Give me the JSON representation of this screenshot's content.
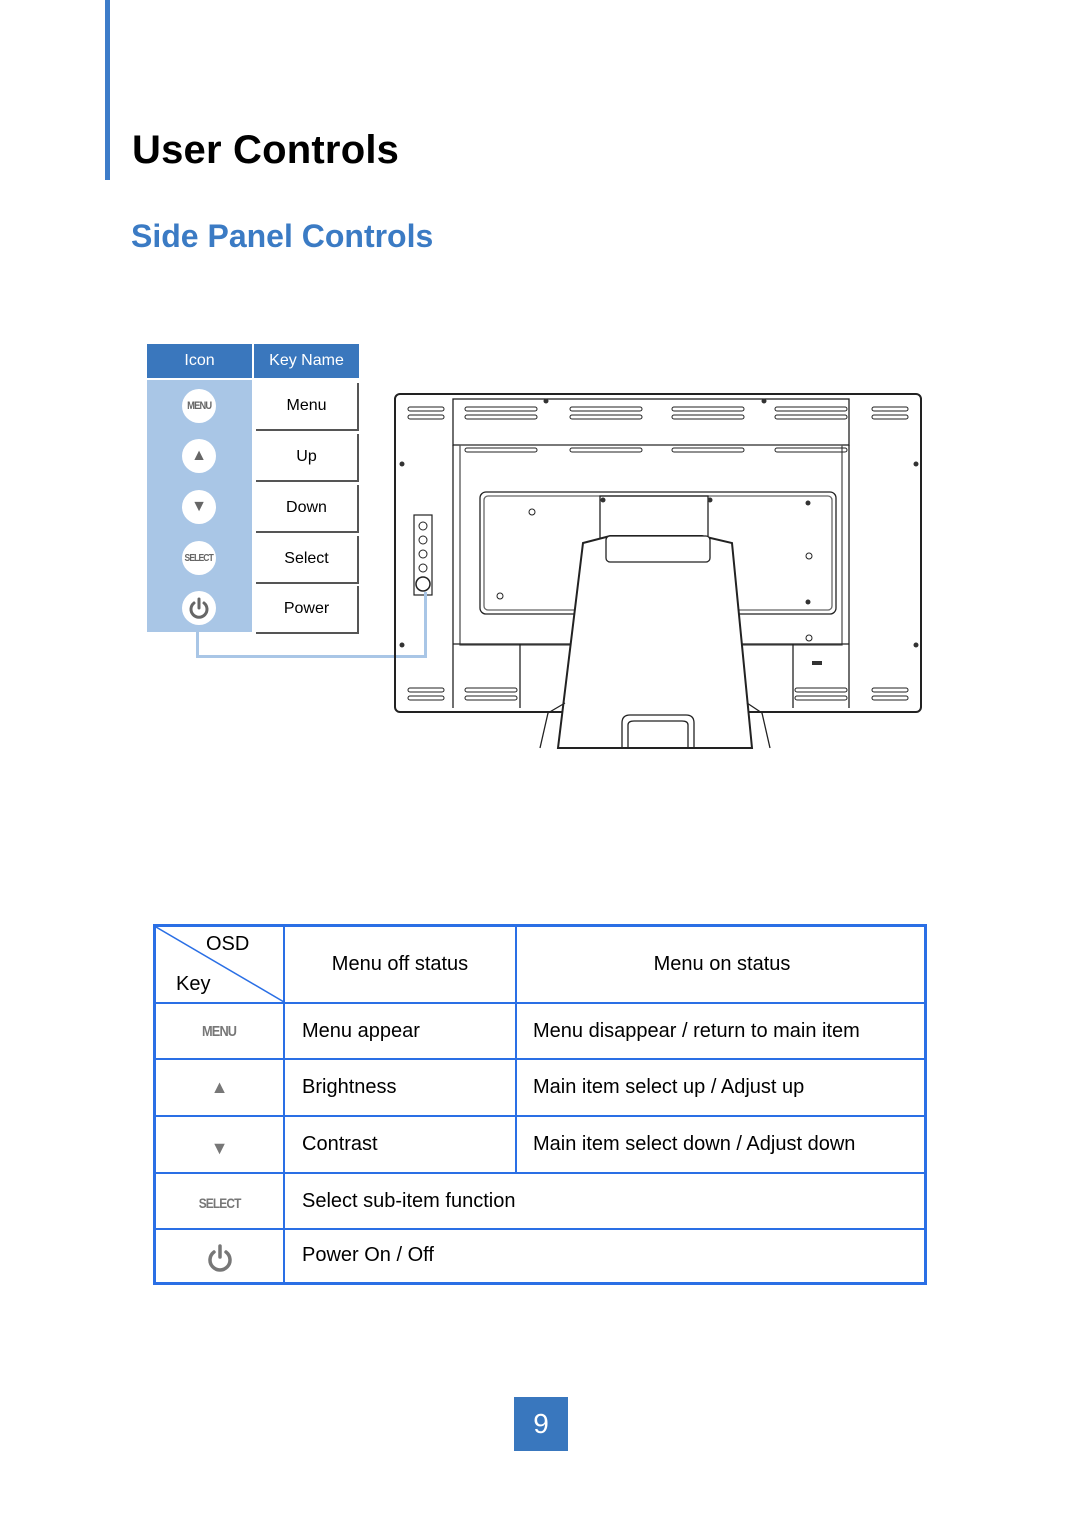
{
  "header": {
    "title": "User Controls",
    "section_title": "Side Panel Controls"
  },
  "key_legend": {
    "headers": {
      "icon": "Icon",
      "key_name": "Key Name"
    },
    "keys": [
      {
        "icon": "menu-icon",
        "icon_text": "MENU",
        "name": "Menu"
      },
      {
        "icon": "up-triangle-icon",
        "icon_text": "▲",
        "name": "Up"
      },
      {
        "icon": "down-triangle-icon",
        "icon_text": "▼",
        "name": "Down"
      },
      {
        "icon": "select-icon",
        "icon_text": "SELECT",
        "name": "Select"
      },
      {
        "icon": "power-icon",
        "icon_text": "",
        "name": "Power"
      }
    ],
    "accent_color": "#3a77bd",
    "icon_column_color": "#a9c6e6"
  },
  "osd_table": {
    "corner": {
      "top": "OSD",
      "bottom": "Key"
    },
    "columns": [
      "Menu off status",
      "Menu on status"
    ],
    "rows": [
      {
        "key_icon": "menu-icon",
        "key_text": "MENU",
        "off": "Menu appear",
        "on": "Menu disappear / return to main item"
      },
      {
        "key_icon": "up-triangle-icon",
        "key_text": "▲",
        "off": "Brightness",
        "on": "Main item select up / Adjust up"
      },
      {
        "key_icon": "down-triangle-icon",
        "key_text": "▼",
        "off": "Contrast",
        "on": "Main item select down / Adjust down"
      },
      {
        "key_icon": "select-icon",
        "key_text": "SELECT",
        "merged": "Select sub-item function"
      },
      {
        "key_icon": "power-icon",
        "key_text": "",
        "merged": "Power On / Off"
      }
    ],
    "border_color": "#2a6fe5"
  },
  "footer": {
    "page_number": "9"
  }
}
